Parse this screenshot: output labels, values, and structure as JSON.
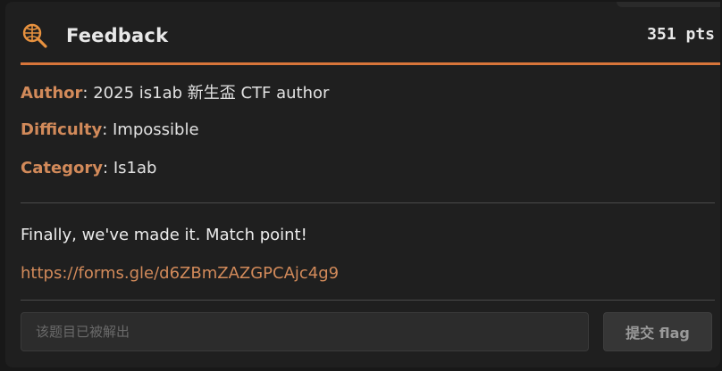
{
  "challenge": {
    "title": "Feedback",
    "points": "351 pts",
    "icon": "magnifier-icon"
  },
  "meta": {
    "author_key": "Author",
    "author_value": ": 2025 is1ab 新生盃 CTF author",
    "difficulty_key": "Difficulty",
    "difficulty_value": ": Impossible",
    "category_key": "Category",
    "category_value": ": Is1ab"
  },
  "description": {
    "text": "Finally, we've made it. Match point!",
    "link": "https://forms.gle/d6ZBmZAZGPCAjc4g9"
  },
  "submission": {
    "placeholder": "该题目已被解出",
    "button_label": "提交 flag"
  },
  "colors": {
    "accent": "#d8753a",
    "key_text": "#d28a5a",
    "background": "#1f1f1f"
  }
}
